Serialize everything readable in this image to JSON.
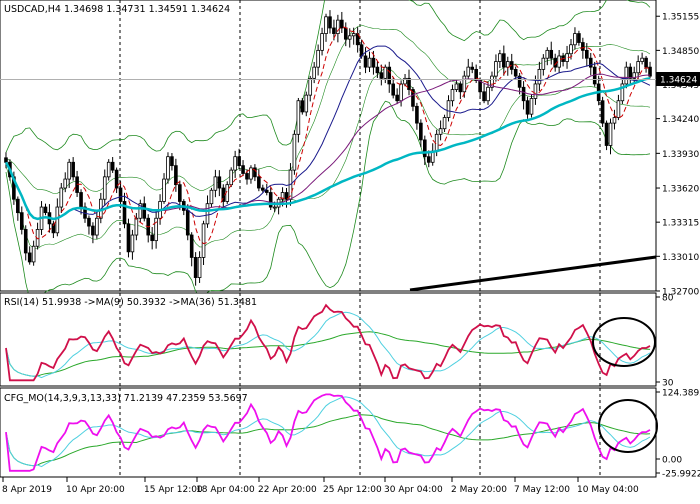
{
  "window": {
    "header": "USDCAD,H4  1.34698 1.34731 1.34591 1.34624",
    "price_tag": "1.34624"
  },
  "colors": {
    "bull": "#000000",
    "bear": "#000000",
    "ma_fast": "#cc0000",
    "ma_mid": "#1a1a8c",
    "ma_slow": "#7a1a7a",
    "ma_long": "#00b7c3",
    "bands": "#1e8a1e",
    "trend": "#000000",
    "rsi_line": "#d0104a",
    "rsi_ma_fast": "#4fd0e0",
    "rsi_ma_slow": "#2aa82a",
    "cfg_line": "#ee10ee",
    "cfg_ma_fast": "#4fd0e0",
    "cfg_ma_slow": "#2aa82a",
    "grid": "#000000",
    "circle": "#000000"
  },
  "chart_data": [
    {
      "type": "candlestick",
      "symbol": "USDCAD",
      "timeframe": "H4",
      "ylim": [
        1.327,
        1.353
      ],
      "y_ticks": [
        "1.35155",
        "1.34850",
        "1.34545",
        "1.34240",
        "1.33930",
        "1.33620",
        "1.33315",
        "1.33010",
        "1.32700"
      ],
      "y_tick_values": [
        1.35155,
        1.3485,
        1.34545,
        1.3424,
        1.3393,
        1.3362,
        1.33315,
        1.3301,
        1.327
      ],
      "last_price": 1.34624,
      "x_labels": [
        "8 Apr 2019",
        "10 Apr 20:00",
        "15 Apr 12:00",
        "18 Apr 04:00",
        "22 Apr 20:00",
        "25 Apr 12:00",
        "30 Apr 04:00",
        "2 May 20:00",
        "7 May 12:00",
        "10 May 04:00"
      ],
      "close_path": [
        1.3385,
        1.3372,
        1.3352,
        1.334,
        1.3325,
        1.3304,
        1.3296,
        1.331,
        1.3325,
        1.3345,
        1.334,
        1.333,
        1.3322,
        1.3345,
        1.3362,
        1.337,
        1.3385,
        1.3372,
        1.3358,
        1.3345,
        1.3335,
        1.3328,
        1.332,
        1.3335,
        1.3352,
        1.3372,
        1.3385,
        1.3378,
        1.3362,
        1.335,
        1.333,
        1.3305,
        1.332,
        1.3335,
        1.3348,
        1.3335,
        1.332,
        1.3315,
        1.3335,
        1.335,
        1.337,
        1.339,
        1.3382,
        1.3365,
        1.335,
        1.3342,
        1.332,
        1.33,
        1.3282,
        1.33,
        1.333,
        1.3348,
        1.336,
        1.3372,
        1.3362,
        1.335,
        1.3365,
        1.3378,
        1.339,
        1.3382,
        1.3375,
        1.337,
        1.338,
        1.3372,
        1.3362,
        1.336,
        1.3358,
        1.3345,
        1.3345,
        1.3352,
        1.3358,
        1.3352,
        1.3378,
        1.341,
        1.344,
        1.343,
        1.3445,
        1.346,
        1.347,
        1.3485,
        1.35,
        1.3515,
        1.3505,
        1.35,
        1.3512,
        1.3505,
        1.3495,
        1.3498,
        1.35,
        1.349,
        1.348,
        1.347,
        1.3478,
        1.347,
        1.3465,
        1.346,
        1.347,
        1.3455,
        1.3445,
        1.344,
        1.3455,
        1.346,
        1.345,
        1.3435,
        1.342,
        1.3405,
        1.339,
        1.3385,
        1.3395,
        1.341,
        1.3415,
        1.3425,
        1.344,
        1.345,
        1.3455,
        1.3448,
        1.3462,
        1.347,
        1.3468,
        1.3458,
        1.3448,
        1.344,
        1.3452,
        1.3462,
        1.3475,
        1.3482,
        1.347,
        1.3475,
        1.3468,
        1.3462,
        1.3452,
        1.344,
        1.3428,
        1.3442,
        1.3455,
        1.3468,
        1.3478,
        1.3485,
        1.3478,
        1.347,
        1.348,
        1.3475,
        1.3482,
        1.349,
        1.35,
        1.3492,
        1.3485,
        1.3478,
        1.347,
        1.3455,
        1.344,
        1.342,
        1.34,
        1.342,
        1.3425,
        1.344,
        1.3455,
        1.347,
        1.346,
        1.3465,
        1.3475,
        1.3478,
        1.347,
        1.3462
      ]
    },
    {
      "type": "line",
      "indicator": "RSI",
      "header": "RSI(14) 51.9938   ->MA(9) 50.3932   ->MA(36) 51.3481",
      "ylim": [
        30,
        80
      ],
      "y_ticks": [
        "80",
        "30"
      ],
      "y_tick_values": [
        80,
        30
      ],
      "series": [
        {
          "name": "RSI(14)",
          "last": 51.9938
        },
        {
          "name": "MA(9)",
          "last": 50.3932
        },
        {
          "name": "MA(36)",
          "last": 51.3481
        }
      ]
    },
    {
      "type": "line",
      "indicator": "CFG_MO",
      "header": "CFG_MO(14,3,9,3,13,33) 71.2139 47.2359 53.5697",
      "ylim": [
        -25.9922,
        124.3892
      ],
      "y_ticks": [
        "124.3892",
        "0.00",
        "-25.9922"
      ],
      "y_tick_values": [
        124.3892,
        0,
        -25.9922
      ],
      "series": [
        {
          "name": "CFG_MO",
          "last": 71.2139
        },
        {
          "name": "signal",
          "last": 47.2359
        },
        {
          "name": "slow",
          "last": 53.5697
        }
      ]
    }
  ]
}
